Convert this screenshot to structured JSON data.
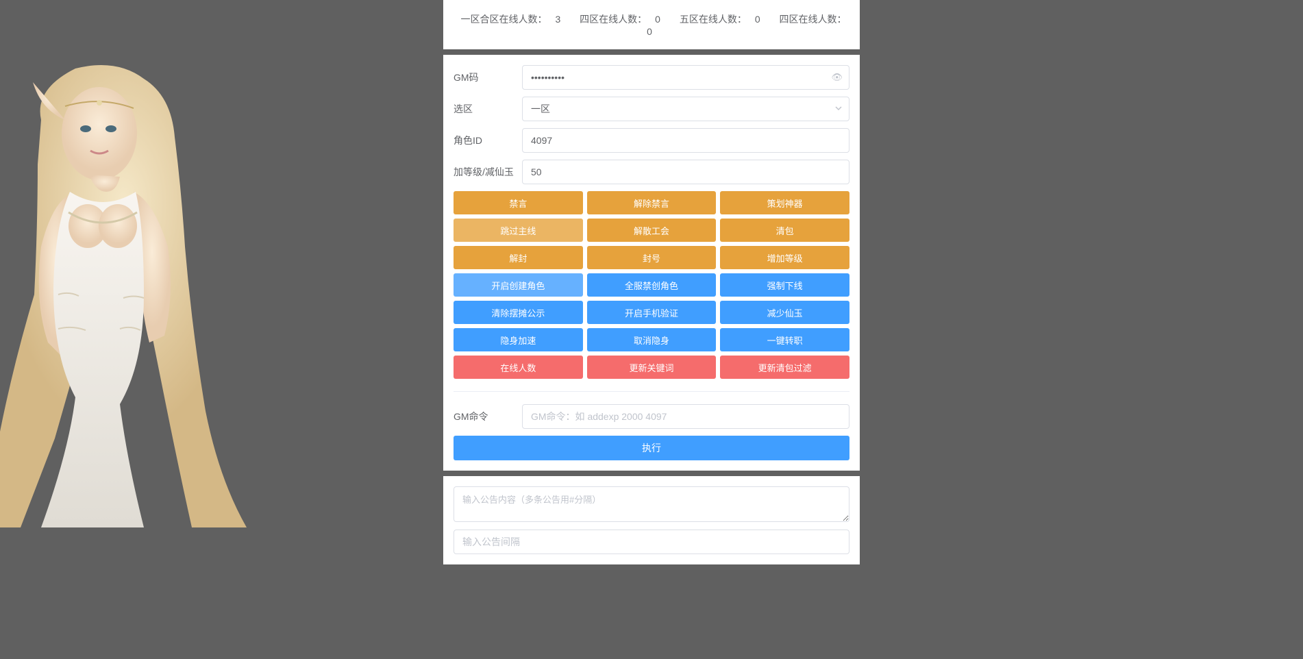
{
  "header": {
    "stats": [
      {
        "label": "一区合区在线人数：",
        "count": "3"
      },
      {
        "label": "四区在线人数：",
        "count": "0"
      },
      {
        "label": "五区在线人数：",
        "count": "0"
      },
      {
        "label": "四区在线人数：",
        "count": "0"
      }
    ]
  },
  "form": {
    "gm_code_label": "GM码",
    "gm_code_value": "••••••••••",
    "zone_label": "选区",
    "zone_value": "一区",
    "role_id_label": "角色ID",
    "role_id_value": "4097",
    "level_label": "加等级/减仙玉",
    "level_value": "50"
  },
  "buttons": {
    "row1": [
      "禁言",
      "解除禁言",
      "策划神器"
    ],
    "row2": [
      "跳过主线",
      "解散工会",
      "清包"
    ],
    "row3": [
      "解封",
      "封号",
      "增加等级"
    ],
    "row4": [
      "开启创建角色",
      "全服禁创角色",
      "强制下线"
    ],
    "row5": [
      "清除摆摊公示",
      "开启手机验证",
      "减少仙玉"
    ],
    "row6": [
      "隐身加速",
      "取消隐身",
      "一键转职"
    ],
    "row7": [
      "在线人数",
      "更新关键词",
      "更新清包过滤"
    ]
  },
  "gm_cmd": {
    "label": "GM命令",
    "placeholder": "GM命令：如 addexp 2000 4097",
    "execute": "执行"
  },
  "announce": {
    "content_placeholder": "输入公告内容（多条公告用#分隔）",
    "interval_placeholder": "输入公告间隔"
  }
}
